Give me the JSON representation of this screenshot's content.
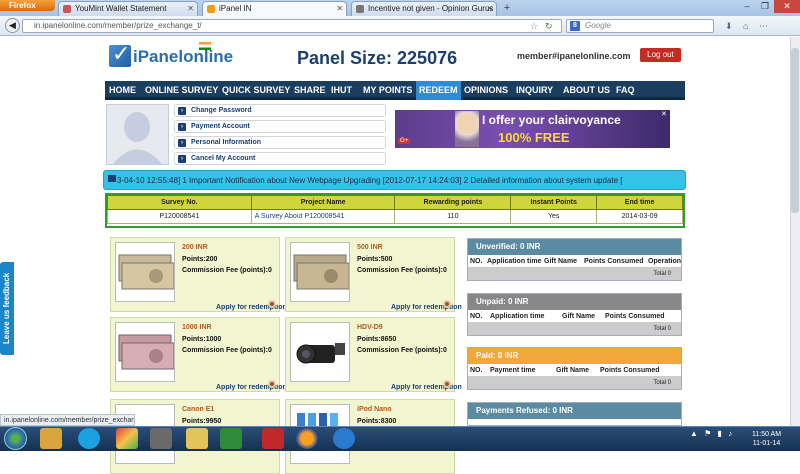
{
  "browser": {
    "menu_label": "Firefox",
    "tabs": [
      {
        "label": "YouMint Wallet Statement",
        "color": "#c55"
      },
      {
        "label": "iPanel IN",
        "color": "#f39c12"
      },
      {
        "label": "Incentive not given - Opinion Gurus - ...",
        "color": "#777"
      }
    ],
    "url": "in.ipanelonline.com/member/prize_exchange_t/",
    "search_placeholder": "Google",
    "new_tab": "+",
    "window_buttons": [
      "–",
      "❐",
      "✕"
    ]
  },
  "header": {
    "logo_text": "iPanelonline",
    "panel_size": "Panel Size: 225076",
    "email": "member#ipanelonline.com",
    "logout": "Log out"
  },
  "nav": {
    "items": [
      "HOME",
      "ONLINE SURVEY",
      "QUICK SURVEY",
      "SHARE",
      "IHUT",
      "MY POINTS",
      "REDEEM",
      "OPINIONS",
      "INQUIRY",
      "ABOUT US",
      "FAQ"
    ],
    "active": "REDEEM"
  },
  "account_menu": [
    "Change Password",
    "Payment Account",
    "Personal Information",
    "Cancel My Account"
  ],
  "ad": {
    "line1": "I offer your clairvoyance",
    "line2": "100% FREE",
    "close": "✕",
    "logo": "G+"
  },
  "ticker": "3-04-10 12:55:48]  1  Important Notification about New Webpage Upgrading  [2012-07-17 14:24:03]  2  Detailed information about system update  [",
  "survey_table": {
    "headers": [
      "Survey No.",
      "Project Name",
      "Rewarding points",
      "Instant Points",
      "End time"
    ],
    "rows": [
      [
        "P120008541",
        "A Survey About P120008541",
        "110",
        "Yes",
        "2014-03-09"
      ]
    ]
  },
  "prizes": [
    {
      "title": "200 INR",
      "points": "Points:200",
      "fee": "Commission Fee (points):0",
      "apply": "Apply for redemption"
    },
    {
      "title": "500 INR",
      "points": "Points:500",
      "fee": "Commission Fee (points):0",
      "apply": "Apply for redemption"
    },
    {
      "title": "1000 INR",
      "points": "Points:1000",
      "fee": "Commission Fee (points):0",
      "apply": "Apply for redemption"
    },
    {
      "title": "HDV-D9",
      "points": "Points:8650",
      "fee": "Commission Fee (points):0",
      "apply": "Apply for redemption"
    },
    {
      "title": "Canon E1",
      "points": "Points:9950",
      "fee": "",
      "apply": ""
    },
    {
      "title": "iPod Nano",
      "points": "Points:8300",
      "fee": "",
      "apply": ""
    }
  ],
  "status_boxes": [
    {
      "title": "Unverified: 0 INR",
      "color": "#5a8ba0",
      "cols": [
        "NO.",
        "Application time",
        "Gift Name",
        "Points Consumed",
        "Operation"
      ],
      "total": "Total 0"
    },
    {
      "title": "Unpaid: 0 INR",
      "color": "#878787",
      "cols": [
        "NO.",
        "Application time",
        "Gift Name",
        "Points Consumed"
      ],
      "total": "Total 0"
    },
    {
      "title": "Paid: 0 INR",
      "color": "#f0a83a",
      "cols": [
        "NO.",
        "Payment time",
        "Gift Name",
        "Points Consumed"
      ],
      "total": "Total 0"
    },
    {
      "title": "Payments Refused: 0 INR",
      "color": "#5a8ba0",
      "cols": [],
      "total": ""
    }
  ],
  "feedback": "Leave us feedback",
  "status_url": "in.ipanelonline.com/member/prize_exchange_t/#",
  "taskbar": {
    "time": "11:50 AM",
    "date": "11-01-14"
  }
}
